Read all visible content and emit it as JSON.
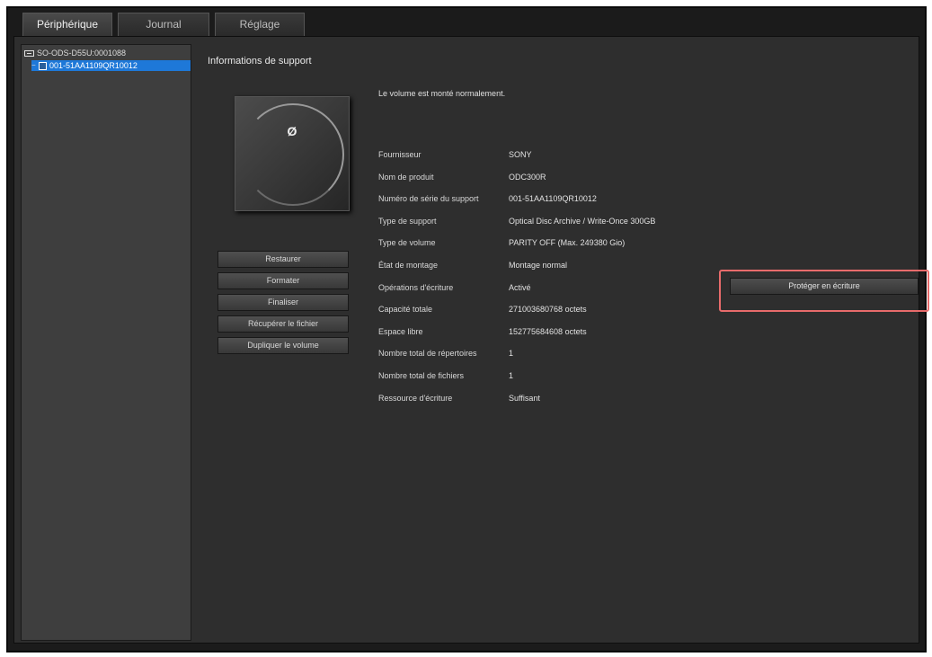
{
  "tabs": [
    {
      "label": "Périphérique"
    },
    {
      "label": "Journal"
    },
    {
      "label": "Réglage"
    }
  ],
  "tree": {
    "root": "SO-ODS-D55U:0001088",
    "child": "001-51AA1109QR10012"
  },
  "panel": {
    "title": "Informations de support",
    "status": "Le volume est monté normalement."
  },
  "actions": [
    "Restaurer",
    "Formater",
    "Finaliser",
    "Récupérer le fichier",
    "Dupliquer le volume"
  ],
  "info": [
    {
      "label": "Fournisseur",
      "value": "SONY"
    },
    {
      "label": "Nom de produit",
      "value": "ODC300R"
    },
    {
      "label": "Numéro de série du support",
      "value": "001-51AA1109QR10012"
    },
    {
      "label": "Type de support",
      "value": "Optical Disc Archive / Write-Once 300GB"
    },
    {
      "label": "Type de volume",
      "value": "PARITY OFF (Max. 249380 Gio)"
    },
    {
      "label": "État de montage",
      "value": "Montage normal"
    },
    {
      "label": "Opérations d'écriture",
      "value": "Activé"
    },
    {
      "label": "Capacité totale",
      "value": "271003680768 octets"
    },
    {
      "label": "Espace libre",
      "value": "152775684608 octets"
    },
    {
      "label": "Nombre total de répertoires",
      "value": "1"
    },
    {
      "label": "Nombre total de fichiers",
      "value": "1"
    },
    {
      "label": "Ressource d'écriture",
      "value": "Suffisant"
    }
  ],
  "protect_button": "Protéger en écriture",
  "colors": {
    "selection": "#1e78d8",
    "highlight_border": "#e86b6b"
  }
}
